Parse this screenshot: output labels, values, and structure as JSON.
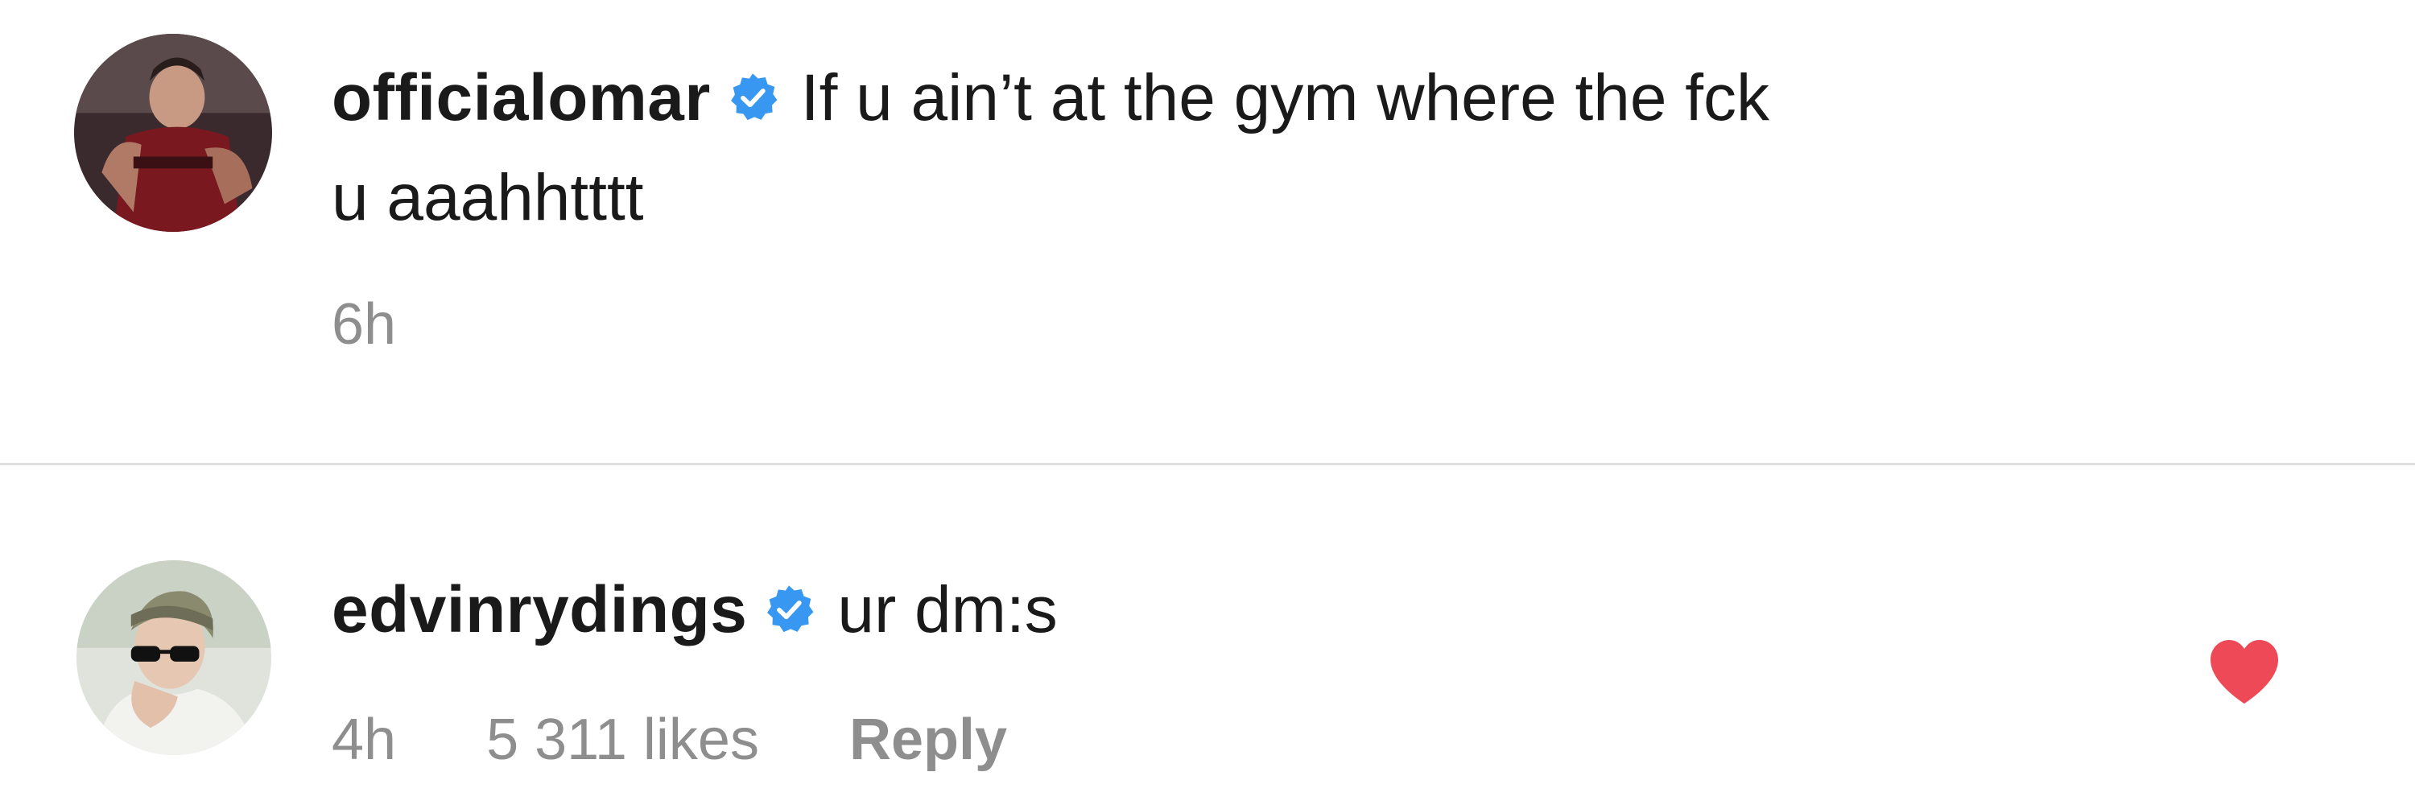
{
  "comments": [
    {
      "username": "officialomar",
      "verified": true,
      "text_line1": "If u ain’t at the gym where the fck",
      "text_line2": "u aaahhtttt",
      "time": "6h"
    },
    {
      "username": "edvinrydings",
      "verified": true,
      "text_line1": "ur dm:s",
      "time": "4h",
      "likes": "5 311 likes",
      "reply_label": "Reply",
      "liked": true
    }
  ],
  "colors": {
    "verified_badge": "#3897f0",
    "like_heart": "#ed4956",
    "meta_text": "#8e8e8e",
    "divider": "#dedede"
  },
  "icons": {
    "verified": "verified-badge-icon",
    "like": "heart-filled-icon"
  }
}
